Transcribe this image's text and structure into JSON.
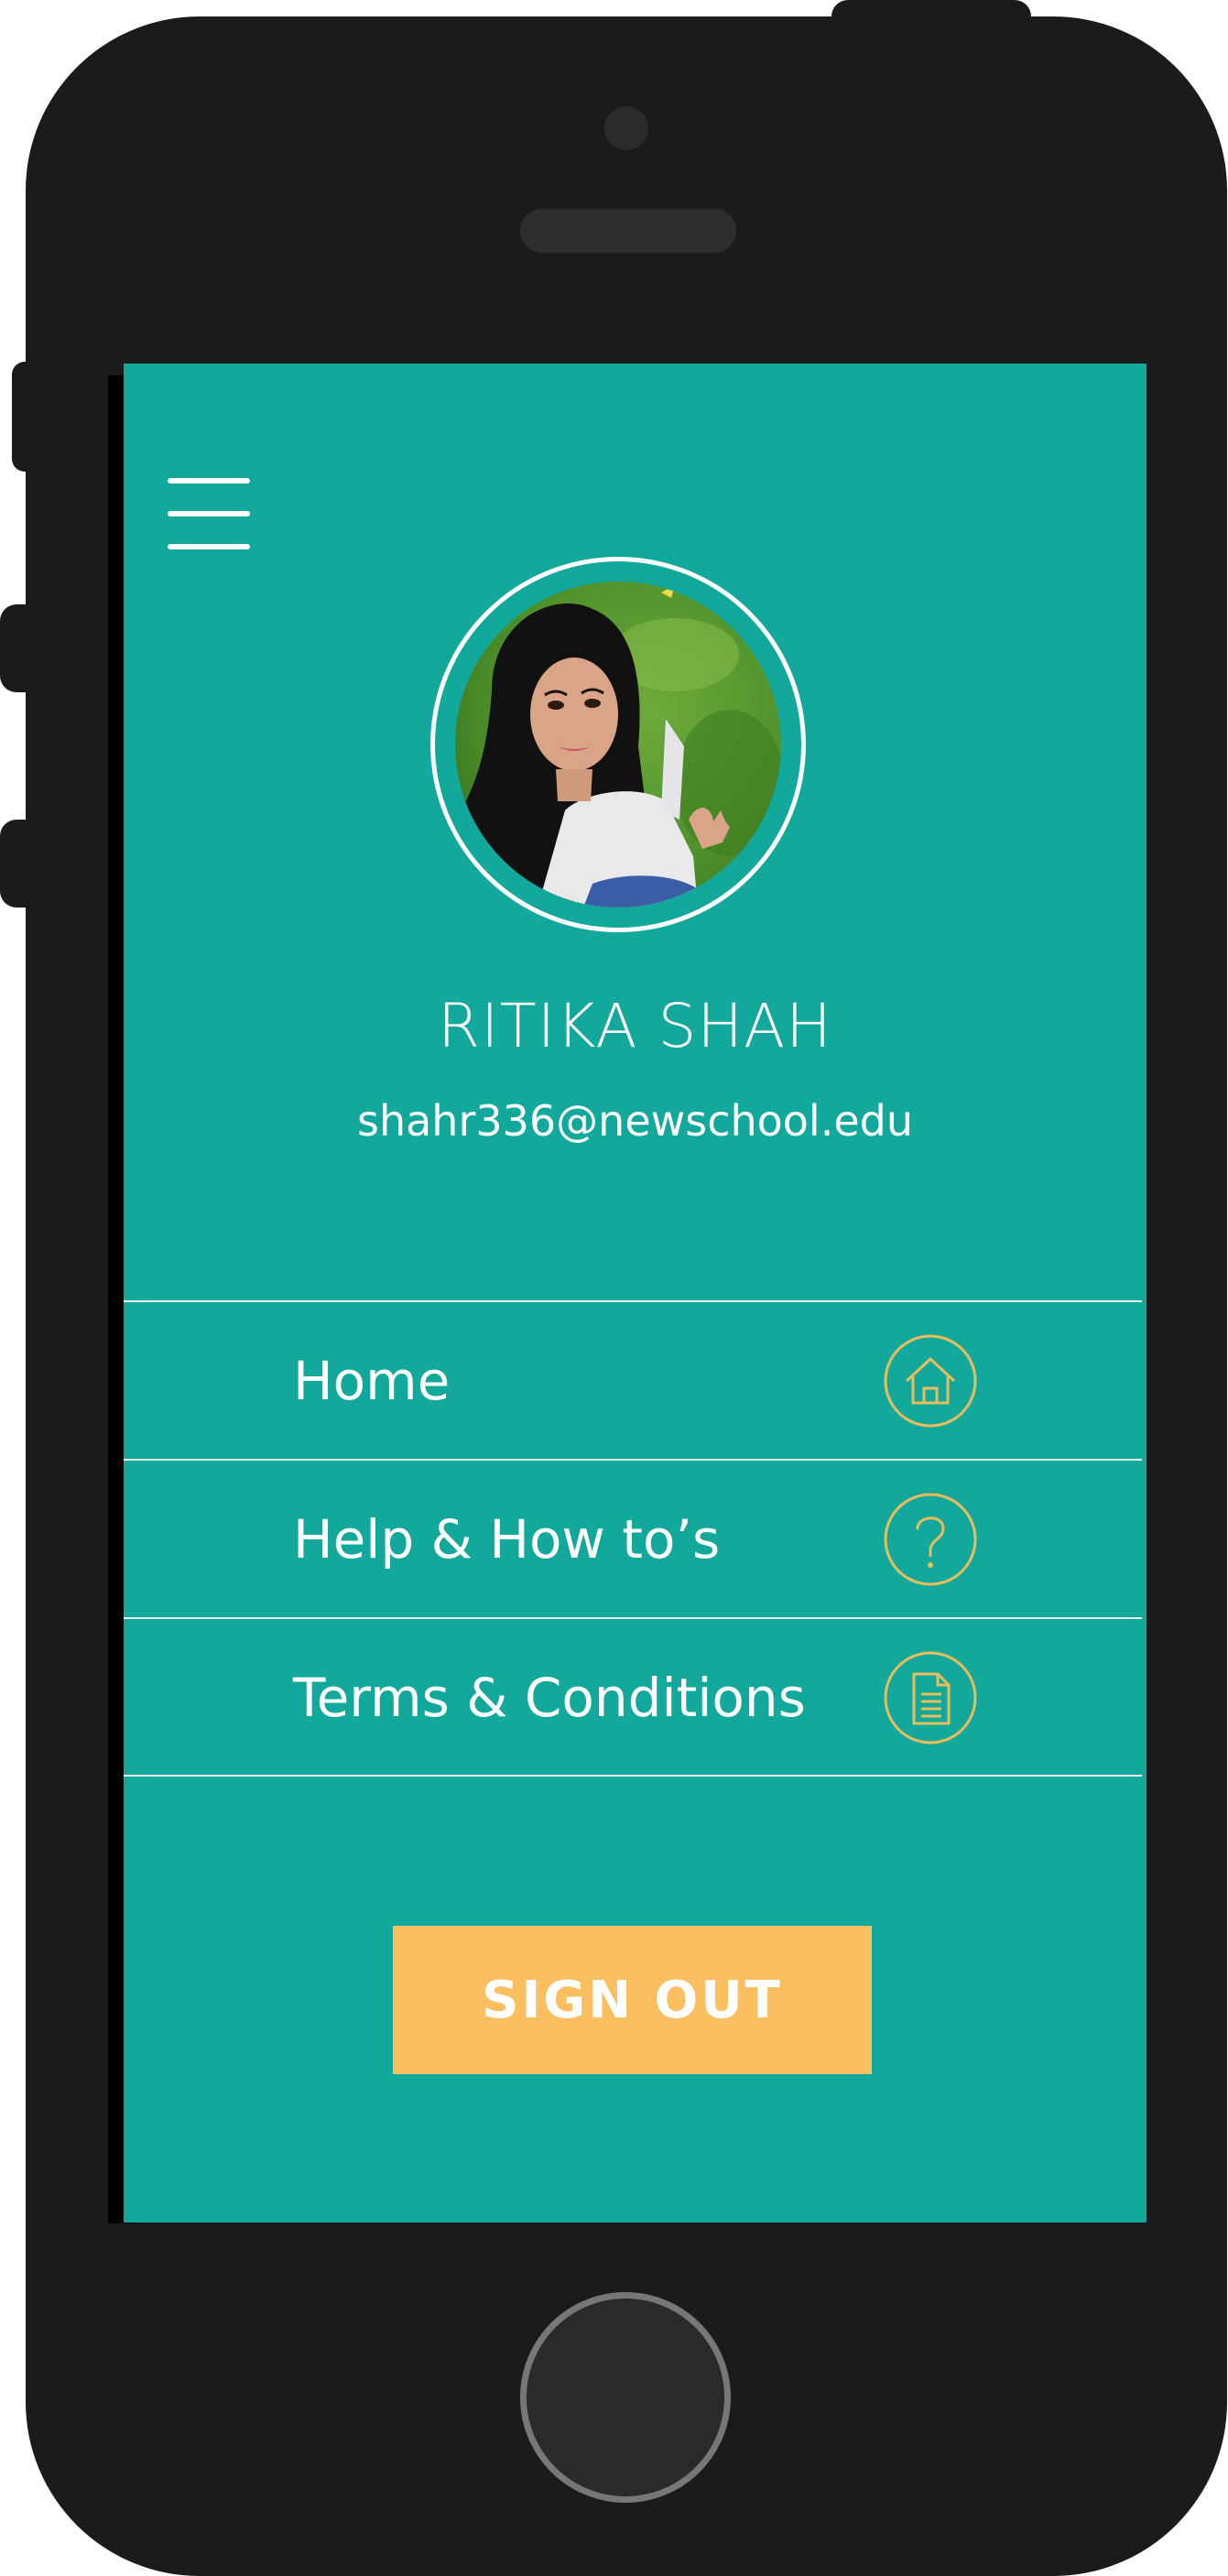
{
  "profile": {
    "name": "RITIKA SHAH",
    "email": "shahr336@newschool.edu"
  },
  "menu": {
    "items": [
      {
        "label": "Home",
        "icon": "home-icon"
      },
      {
        "label": "Help & How to’s",
        "icon": "question-icon"
      },
      {
        "label": "Terms & Conditions",
        "icon": "document-icon"
      }
    ]
  },
  "actions": {
    "sign_out_label": "SIGN OUT"
  },
  "colors": {
    "screen_background": "#12a89b",
    "accent_gold": "#e8bd5c",
    "sign_out_button": "#fbbf5f",
    "device_body": "#1b1b1b"
  }
}
